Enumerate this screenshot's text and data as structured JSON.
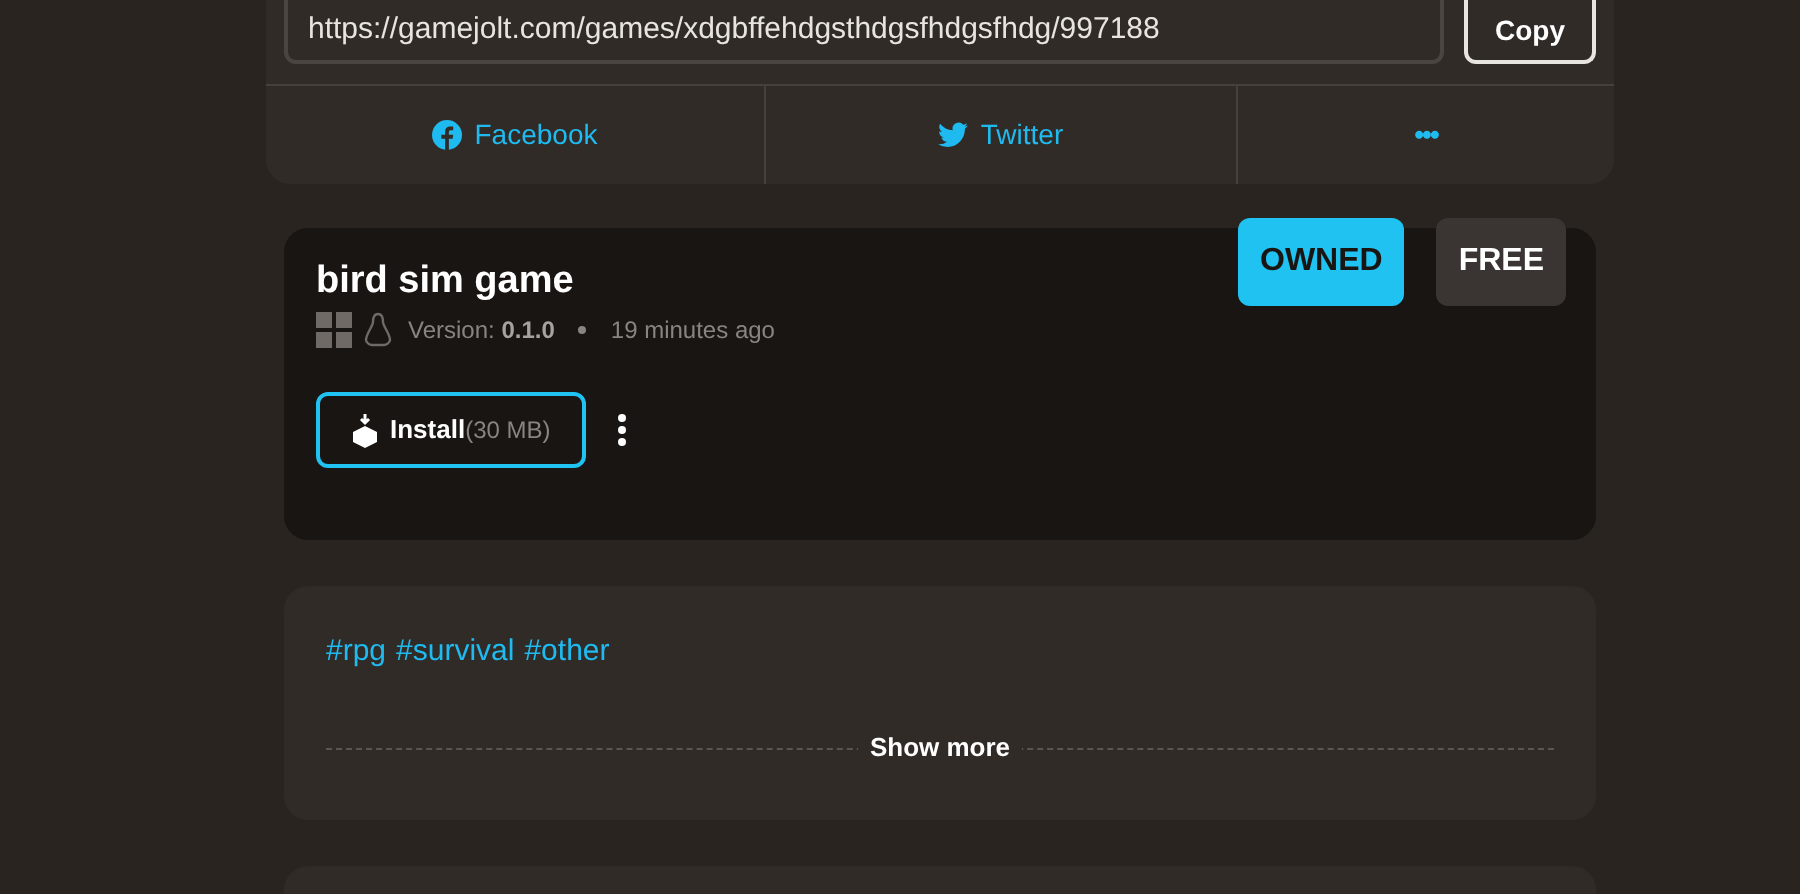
{
  "share": {
    "url": "https://gamejolt.com/games/xdgbffehdgsthdgsfhdgsfhdg/997188",
    "copy_label": "Copy",
    "links": [
      {
        "kind": "facebook",
        "label": "Facebook"
      },
      {
        "kind": "twitter",
        "label": "Twitter"
      },
      {
        "kind": "more",
        "label": "•••"
      }
    ]
  },
  "build": {
    "title": "bird sim game",
    "badges": [
      {
        "kind": "owned",
        "label": "OWNED"
      },
      {
        "kind": "price",
        "label": "FREE"
      }
    ],
    "platforms": [
      {
        "kind": "windows"
      },
      {
        "kind": "linux"
      }
    ],
    "version_label": "Version:",
    "version": "0.1.0",
    "time": "19 minutes ago",
    "install_label": "Install",
    "install_size": "(30 MB)"
  },
  "tags": [
    "#rpg",
    "#survival",
    "#other"
  ],
  "show_more": "Show more"
}
